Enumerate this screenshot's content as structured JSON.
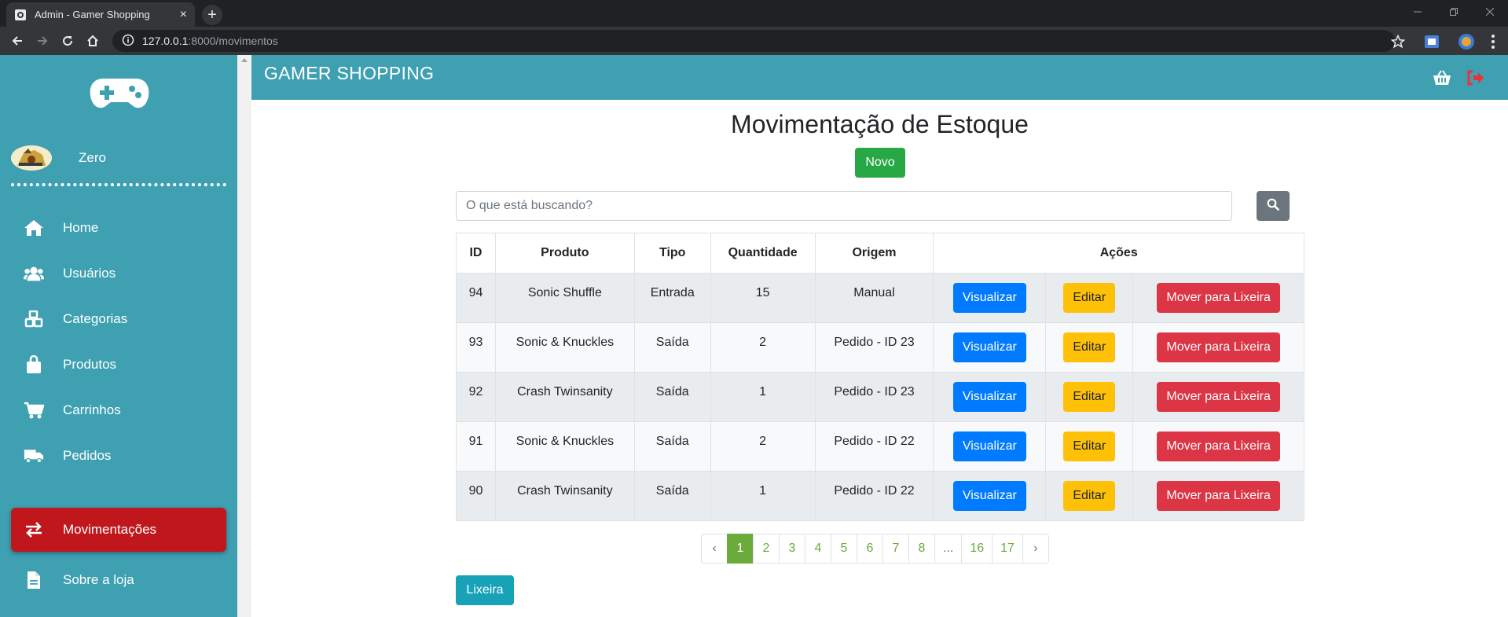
{
  "browser": {
    "tab_title": "Admin - Gamer Shopping",
    "tab_close": "×",
    "new_tab": "+",
    "url_host": "127.0.0.1",
    "url_path": ":8000/movimentos"
  },
  "sidebar": {
    "user_name": "Zero",
    "items": [
      {
        "label": "Home",
        "icon": "home-icon"
      },
      {
        "label": "Usuários",
        "icon": "users-icon"
      },
      {
        "label": "Categorias",
        "icon": "cubes-icon"
      },
      {
        "label": "Produtos",
        "icon": "shopping-bag-icon"
      },
      {
        "label": "Carrinhos",
        "icon": "cart-icon"
      },
      {
        "label": "Pedidos",
        "icon": "truck-icon"
      },
      {
        "label": "Movimentações",
        "icon": "exchange-icon",
        "active": true
      },
      {
        "label": "Sobre a loja",
        "icon": "file-icon"
      }
    ]
  },
  "header": {
    "brand": "GAMER SHOPPING"
  },
  "main": {
    "title": "Movimentação de Estoque",
    "new_button": "Novo",
    "search_placeholder": "O que está buscando?",
    "columns": [
      "ID",
      "Produto",
      "Tipo",
      "Quantidade",
      "Origem",
      "Ações"
    ],
    "rows": [
      {
        "id": "94",
        "produto": "Sonic Shuffle",
        "tipo": "Entrada",
        "quantidade": "15",
        "origem": "Manual"
      },
      {
        "id": "93",
        "produto": "Sonic & Knuckles",
        "tipo": "Saída",
        "quantidade": "2",
        "origem": "Pedido - ID 23"
      },
      {
        "id": "92",
        "produto": "Crash Twinsanity",
        "tipo": "Saída",
        "quantidade": "1",
        "origem": "Pedido - ID 23"
      },
      {
        "id": "91",
        "produto": "Sonic & Knuckles",
        "tipo": "Saída",
        "quantidade": "2",
        "origem": "Pedido - ID 22"
      },
      {
        "id": "90",
        "produto": "Crash Twinsanity",
        "tipo": "Saída",
        "quantidade": "1",
        "origem": "Pedido - ID 22"
      }
    ],
    "actions": {
      "view": "Visualizar",
      "edit": "Editar",
      "trash": "Mover para Lixeira"
    },
    "pagination": {
      "prev": "‹",
      "pages": [
        "1",
        "2",
        "3",
        "4",
        "5",
        "6",
        "7",
        "8",
        "...",
        "16",
        "17"
      ],
      "next": "›",
      "current": "1"
    },
    "trash_button": "Lixeira"
  },
  "colors": {
    "teal": "#3fa0b2",
    "active_nav": "#c0171d",
    "success": "#28a745",
    "primary": "#007bff",
    "warning": "#ffc107",
    "danger": "#dc3545",
    "info": "#17a2b8",
    "pagination_green": "#6aab3b"
  }
}
